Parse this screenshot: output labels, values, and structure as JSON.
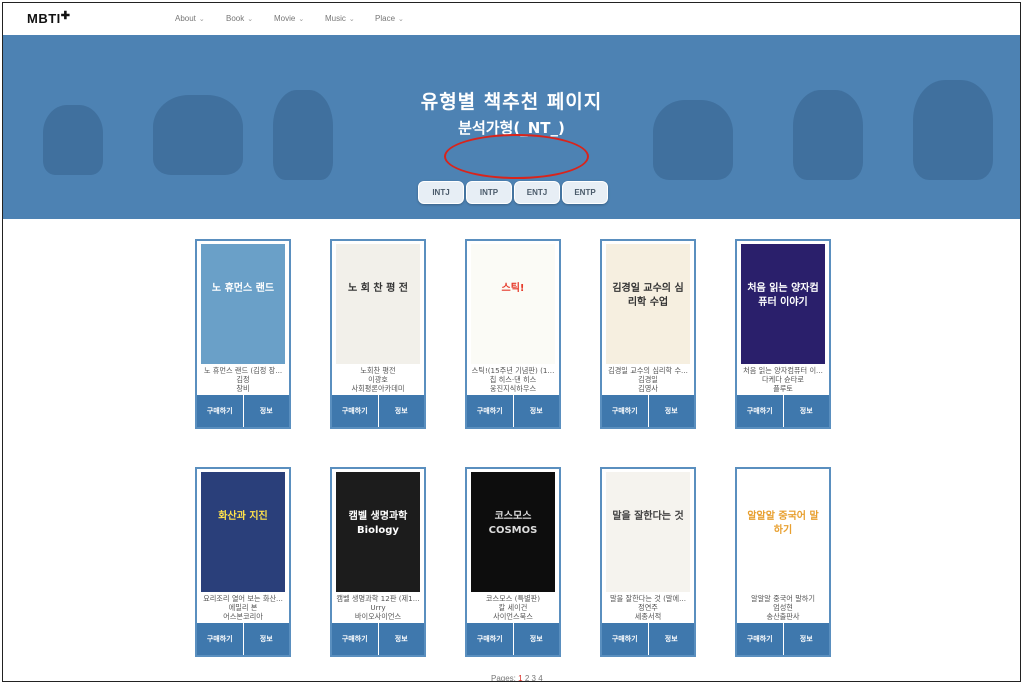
{
  "brand": {
    "name": "MBTI"
  },
  "nav": [
    {
      "label": "About"
    },
    {
      "label": "Book"
    },
    {
      "label": "Movie"
    },
    {
      "label": "Music"
    },
    {
      "label": "Place"
    }
  ],
  "hero": {
    "title": "유형별 책추천 페이지",
    "subtitle": "분석가형(_NT_)",
    "types": [
      {
        "label": "INTJ"
      },
      {
        "label": "INTP"
      },
      {
        "label": "ENTJ"
      },
      {
        "label": "ENTP"
      }
    ]
  },
  "buttons": {
    "buy": "구매하기",
    "info": "정보"
  },
  "books": [
    {
      "title": "노 휴먼스 랜드 (김정 장...",
      "author": "김정",
      "publisher": "창비",
      "cover_text": "노 휴먼스 랜드",
      "cover_bg": "#6aa0c8",
      "cover_fg": "#ffffff"
    },
    {
      "title": "노회찬 평전",
      "author": "이광호",
      "publisher": "사회평론아카데미",
      "cover_text": "노 회 찬 평 전",
      "cover_bg": "#f2f0ea",
      "cover_fg": "#333333"
    },
    {
      "title": "스틱!(15주년 기념판) (1...",
      "author": "칩 히스·댄 히스",
      "publisher": "웅진지식하우스",
      "cover_text": "스틱!",
      "cover_bg": "#fbfbf6",
      "cover_fg": "#e63a2a"
    },
    {
      "title": "김경일 교수의 심리학 수...",
      "author": "김경일",
      "publisher": "김영사",
      "cover_text": "김경일 교수의 심리학 수업",
      "cover_bg": "#f6efe0",
      "cover_fg": "#333333"
    },
    {
      "title": "처음 읽는 양자컴퓨터 이...",
      "author": "다케다 슌타로",
      "publisher": "플루토",
      "cover_text": "처음 읽는 양자컴퓨터 이야기",
      "cover_bg": "#2a1f6b",
      "cover_fg": "#ffffff"
    },
    {
      "title": "요리조리 열어 보는 화산...",
      "author": "에밀리 본",
      "publisher": "어스본코리아",
      "cover_text": "화산과 지진",
      "cover_bg": "#2a3f7a",
      "cover_fg": "#ffe24a"
    },
    {
      "title": "캠벨 생명과학 12판 (제1...",
      "author": "Urry",
      "publisher": "바이오사이언스",
      "cover_text": "캠벨 생명과학 Biology",
      "cover_bg": "#1c1c1c",
      "cover_fg": "#ffffff"
    },
    {
      "title": "코스모스 (특별판)",
      "author": "칼 세이건",
      "publisher": "사이언스북스",
      "cover_text": "코스모스 COSMOS",
      "cover_bg": "#0d0d0d",
      "cover_fg": "#dddddd"
    },
    {
      "title": "말을 잘한다는 것 (말에...",
      "author": "정연주",
      "publisher": "세종서적",
      "cover_text": "말을 잘한다는 것",
      "cover_bg": "#f5f3ee",
      "cover_fg": "#444444"
    },
    {
      "title": "알알알 중국어 말하기",
      "author": "엄성현",
      "publisher": "송산출판사",
      "cover_text": "알알알 중국어 말하기",
      "cover_bg": "#ffffff",
      "cover_fg": "#e8a030"
    }
  ],
  "pager": {
    "label": "Pages:",
    "pages": [
      "1",
      "2",
      "3",
      "4"
    ]
  }
}
